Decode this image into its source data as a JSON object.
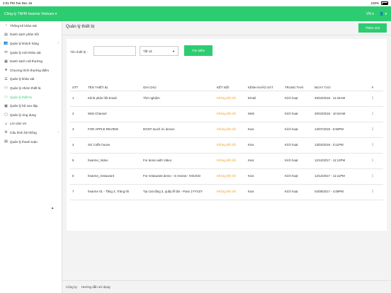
{
  "status_bar": {
    "time": "2:01 PM",
    "date": "Tue Dec 18",
    "battery": "100%"
  },
  "topbar": {
    "company": "Công ty TNHH hearme Vietnam ▾",
    "lang": "VN ▾",
    "user": "👤 ▾"
  },
  "sidebar": {
    "items": [
      {
        "label": "Thống kê khảo sát",
        "icon": "◔"
      },
      {
        "label": "Danh sách phản hồi",
        "icon": "▤"
      },
      {
        "label": "Quản lý khách hàng",
        "icon": "👥",
        "chev": "›"
      },
      {
        "label": "Quản lý mời khảo sát",
        "icon": "✉"
      },
      {
        "label": "Danh sách mã thưởng",
        "icon": "▦"
      },
      {
        "label": "Chương trình thưởng điểm",
        "icon": "★"
      },
      {
        "label": "Quản lý khảo sát",
        "icon": "☰"
      },
      {
        "label": "Quản lý nhóm thiết bị",
        "icon": "▭"
      },
      {
        "label": "Quản lý thiết bị",
        "icon": "▭",
        "active": true
      },
      {
        "label": "Quản lý bộ sưu tập",
        "icon": "▣"
      },
      {
        "label": "Quản lý ứng dụng",
        "icon": "▢"
      },
      {
        "label": "Lời cảm ơn",
        "icon": "☺"
      },
      {
        "label": "Cấu hình hệ thống",
        "icon": "⚙",
        "chev": "›"
      },
      {
        "label": "Quản lý thanh toán",
        "icon": "▤"
      }
    ],
    "collapse_icon": "✦"
  },
  "header": {
    "title": "Quản lý thiết bị",
    "add_label": "Thêm mới"
  },
  "filter": {
    "name_label": "Tên thiết bị :",
    "name_value": "",
    "select_value": "Tất cả",
    "search_label": "Tìm kiếm"
  },
  "table": {
    "columns": [
      "STT",
      "TÊN THIẾT BỊ",
      "GHI CHÚ",
      "KẾT NỐI",
      "KÊNH KHẢO SÁT",
      "TRẠNG THÁI",
      "NGÀY TẠO",
      "#"
    ],
    "rows": [
      {
        "stt": "1",
        "name": "Kênh phản hồi Email",
        "note": "Thử nghiệm",
        "conn": "Không kết nối",
        "channel": "Email",
        "status": "Kích hoạt",
        "created": "29/10/2018 - 11:34AM"
      },
      {
        "stt": "2",
        "name": "Web Channel",
        "note": "",
        "conn": "Không kết nối",
        "channel": "Web",
        "status": "Kích hoạt",
        "created": "29/10/2018 - 10:34AM"
      },
      {
        "stt": "3",
        "name": "FOR APPLE REVIEW",
        "note": "DONT touch ớc device",
        "conn": "Không kết nối",
        "channel": "Kios",
        "status": "Kích hoạt",
        "created": "13/07/2018 - 5:50PM"
      },
      {
        "stt": "4",
        "name": "SG Coffe house",
        "note": "",
        "conn": "Không kết nối",
        "channel": "Kios",
        "status": "Kích hoạt",
        "created": "13/04/2018 - 3:11PM"
      },
      {
        "stt": "5",
        "name": "hearme_Video",
        "note": "For demo with Video",
        "conn": "Không kết nối",
        "channel": "Kios",
        "status": "Kích hoạt",
        "created": "12/12/2017 - 11:12PM"
      },
      {
        "stt": "6",
        "name": "hearme_restaurant",
        "note": "For restaurant demo - in review:- IVDJGD",
        "conn": "Không kết nối",
        "channel": "Kios",
        "status": "Kích hoạt",
        "created": "12/12/2017 - 11:11PM"
      },
      {
        "stt": "7",
        "name": "hearme 01 - Tầng 3, Tràng thi",
        "note": "Tại cửa tầng 3, quầy lễ tân - Pass 1YYVZY",
        "conn": "Không kết nối",
        "channel": "Kios",
        "status": "Kích hoạt",
        "created": "04/08/2017 - 4:09PM"
      }
    ],
    "actions_icon": "⋮"
  },
  "footer": {
    "copyright": "Công ty:",
    "guide": "Hướng dẫn sử dụng"
  },
  "colors": {
    "accent": "#2ecc71",
    "link": "#f39c12"
  }
}
